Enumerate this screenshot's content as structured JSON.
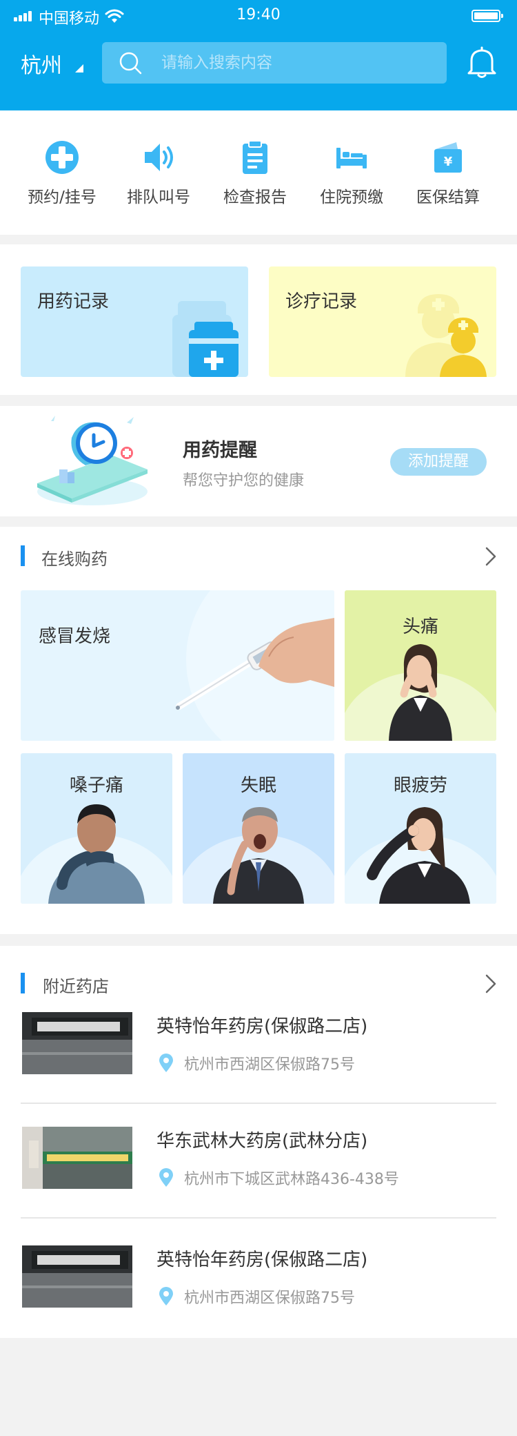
{
  "status_bar": {
    "carrier": "中国移动",
    "time": "19:40"
  },
  "header": {
    "city": "杭州",
    "search_placeholder": "请输入搜索内容",
    "bell_icon": "bell-icon"
  },
  "services": [
    {
      "label": "预约/挂号",
      "icon": "plus-cross-icon"
    },
    {
      "label": "排队叫号",
      "icon": "speaker-icon"
    },
    {
      "label": "检查报告",
      "icon": "clipboard-icon"
    },
    {
      "label": "住院预缴",
      "icon": "bed-icon"
    },
    {
      "label": "医保结算",
      "icon": "wallet-yen-icon"
    }
  ],
  "records": {
    "medication": "用药记录",
    "consultation": "诊疗记录"
  },
  "reminder": {
    "title": "用药提醒",
    "subtitle": "帮您守护您的健康",
    "button": "添加提醒"
  },
  "online_pharmacy": {
    "title": "在线购药",
    "categories": [
      "感冒发烧",
      "头痛",
      "嗓子痛",
      "失眠",
      "眼疲劳"
    ]
  },
  "nearby": {
    "title": "附近药店",
    "stores": [
      {
        "name": "英特怡年药房(保俶路二店)",
        "address": "杭州市西湖区保俶路75号"
      },
      {
        "name": "华东武林大药房(武林分店)",
        "address": "杭州市下城区武林路436-438号"
      },
      {
        "name": "英特怡年药房(保俶路二店)",
        "address": "杭州市西湖区保俶路75号"
      }
    ]
  },
  "colors": {
    "header": "#07a8ec",
    "icon_blue": "#3bb7f4",
    "accent_bar": "#1a91f0",
    "medication_card": "#c9ecfd",
    "consultation_card": "#fdfdc5"
  }
}
